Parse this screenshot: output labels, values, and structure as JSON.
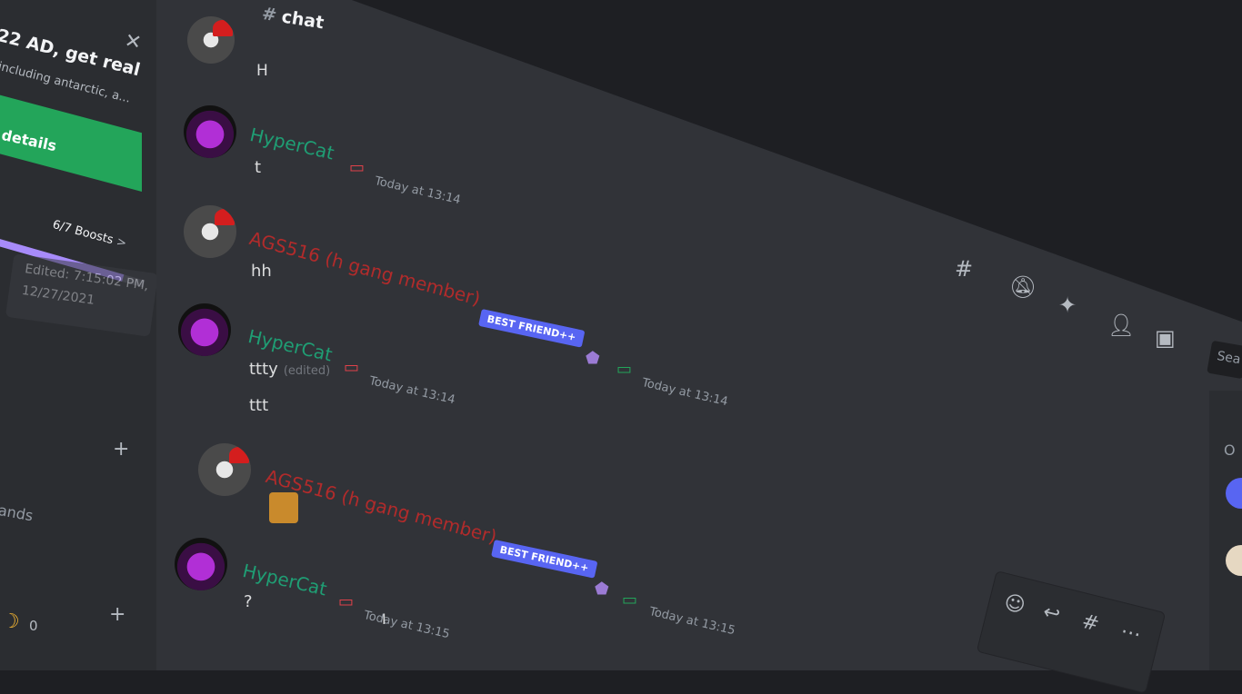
{
  "sidebar": {
    "event_title": "22 AD, get real",
    "event_subtitle": "including antarctic, a...",
    "details_label": "details",
    "boosts": "6/7 Boosts",
    "boosts_chevron": ">",
    "boost_progress": 0.86,
    "tooltip_line1": "Edited: 7:15:02 PM,",
    "tooltip_line2": "12/27/2021",
    "category_label": "ands",
    "moon_count": "0"
  },
  "header": {
    "hash": "#",
    "channel": "chat"
  },
  "messages": [
    {
      "user": "",
      "text": "H",
      "time": ""
    },
    {
      "user": "HyperCat",
      "text": "t",
      "time": "Today at 13:14"
    },
    {
      "user": "AGS516 (h gang member)",
      "badge": "BEST FRIEND++",
      "text": "hh",
      "time": "Today at 13:14"
    },
    {
      "user": "HyperCat",
      "text": "ttty",
      "edited": "(edited)",
      "text2": "ttt",
      "time": "Today at 13:14"
    },
    {
      "user": "AGS516 (h gang member)",
      "badge": "BEST FRIEND++",
      "time": "Today at 13:15"
    },
    {
      "user": "HyperCat",
      "text": "?",
      "time": "Today at 13:15"
    }
  ],
  "members": {
    "header": "O"
  },
  "search": {
    "placeholder": "Sea"
  },
  "icons": {
    "threads": "threads-icon",
    "mute": "bell-slash-icon",
    "pin": "pin-icon",
    "members": "members-icon",
    "inbox": "inbox-icon",
    "add_reaction": "add-reaction-icon",
    "reply": "reply-icon",
    "more": "more-icon"
  },
  "colors": {
    "accent": "#5865f2",
    "green_role": "#1f9e74",
    "red_role": "#b12b2b",
    "details_button": "#23a55a"
  }
}
